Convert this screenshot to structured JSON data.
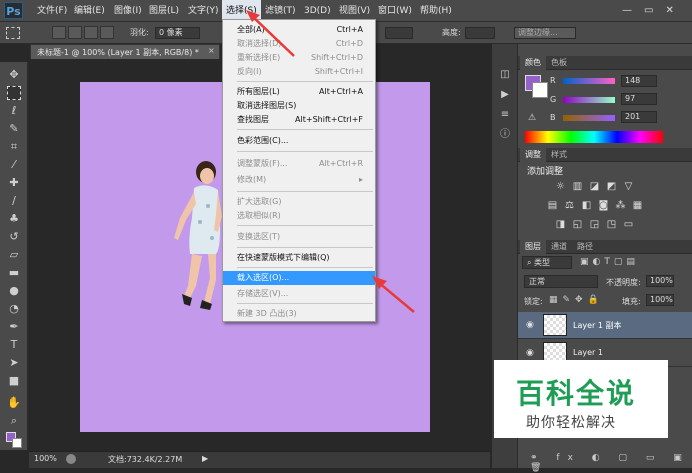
{
  "app": {
    "logo": "Ps"
  },
  "menubar": {
    "items": [
      "文件(F)",
      "编辑(E)",
      "图像(I)",
      "图层(L)",
      "文字(Y)",
      "选择(S)",
      "滤镜(T)",
      "3D(D)",
      "视图(V)",
      "窗口(W)",
      "帮助(H)"
    ],
    "active_index": 5
  },
  "options": {
    "feather_label": "羽化:",
    "feather_value": "0 像素",
    "height_label": "高度:",
    "refine_label": "调整边缘..."
  },
  "document": {
    "tab_title": "未标题-1 @ 100% (Layer 1 副本, RGB/8) *",
    "canvas_color": "#c39aeb"
  },
  "status": {
    "zoom": "100%",
    "doc_info": "文档:732.4K/2.27M"
  },
  "select_menu": {
    "items": [
      {
        "label": "全部(A)",
        "shortcut": "Ctrl+A",
        "disabled": false
      },
      {
        "label": "取消选择(D)",
        "shortcut": "Ctrl+D",
        "disabled": true
      },
      {
        "label": "重新选择(E)",
        "shortcut": "Shift+Ctrl+D",
        "disabled": true
      },
      {
        "label": "反向(I)",
        "shortcut": "Shift+Ctrl+I",
        "disabled": true
      },
      {
        "label": "所有图层(L)",
        "shortcut": "Alt+Ctrl+A",
        "disabled": false
      },
      {
        "label": "取消选择图层(S)",
        "shortcut": "",
        "disabled": false
      },
      {
        "label": "查找图层",
        "shortcut": "Alt+Shift+Ctrl+F",
        "disabled": false
      },
      {
        "label": "色彩范围(C)...",
        "shortcut": "",
        "disabled": false
      },
      {
        "label": "调整蒙版(F)...",
        "shortcut": "Alt+Ctrl+R",
        "disabled": true
      },
      {
        "label": "修改(M)",
        "shortcut": "▸",
        "disabled": true
      },
      {
        "label": "扩大选取(G)",
        "shortcut": "",
        "disabled": true
      },
      {
        "label": "选取相似(R)",
        "shortcut": "",
        "disabled": true
      },
      {
        "label": "变换选区(T)",
        "shortcut": "",
        "disabled": true
      },
      {
        "label": "在快速蒙版模式下编辑(Q)",
        "shortcut": "",
        "disabled": false
      },
      {
        "label": "载入选区(O)...",
        "shortcut": "",
        "disabled": false,
        "highlighted": true
      },
      {
        "label": "存储选区(V)...",
        "shortcut": "",
        "disabled": true
      },
      {
        "label": "新建 3D 凸出(3)",
        "shortcut": "",
        "disabled": true
      }
    ]
  },
  "color_panel": {
    "tabs": [
      "颜色",
      "色板"
    ],
    "r_label": "R",
    "g_label": "G",
    "b_label": "B",
    "r": "148",
    "g": "97",
    "b": "201",
    "foreground": "#9461c9"
  },
  "adjust_panel": {
    "tabs": [
      "调整",
      "样式"
    ],
    "title": "添加调整"
  },
  "layers_panel": {
    "tabs": [
      "图层",
      "通道",
      "路径"
    ],
    "filter": "类型",
    "blend_mode": "正常",
    "opacity_label": "不透明度:",
    "opacity": "100%",
    "lock_label": "锁定:",
    "fill_label": "填充:",
    "fill": "100%",
    "layers": [
      "Layer 1 副本",
      "Layer 1"
    ]
  },
  "watermark": {
    "title": "百科全说",
    "subtitle": "助你轻松解决"
  },
  "colors": {
    "arrow": "#e83a3a",
    "highlight": "#3399ff"
  }
}
